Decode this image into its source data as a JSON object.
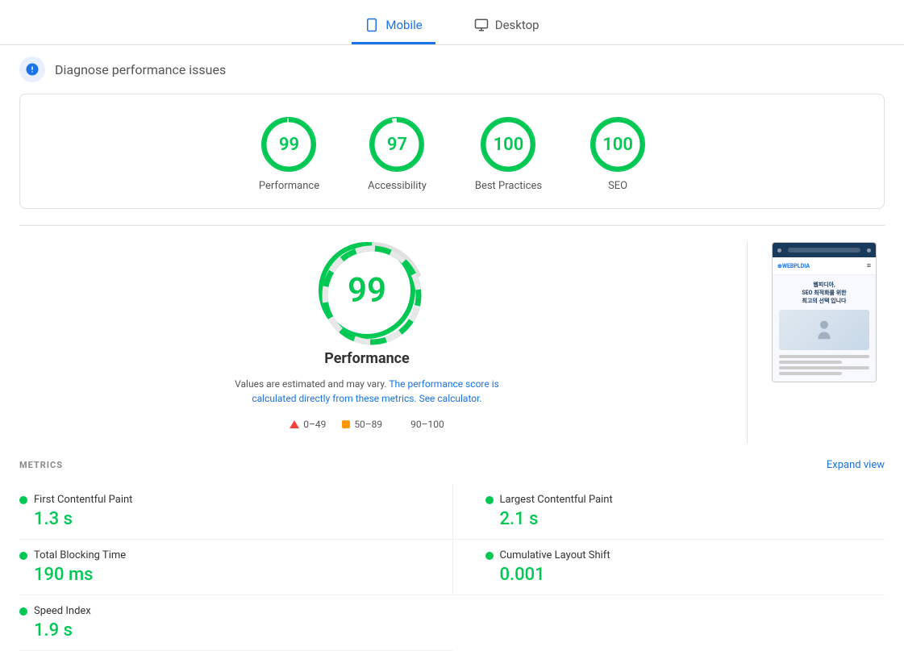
{
  "header": {
    "diagnose_label": "Diagnose performance issues"
  },
  "tabs": [
    {
      "id": "mobile",
      "label": "Mobile",
      "active": true
    },
    {
      "id": "desktop",
      "label": "Desktop",
      "active": false
    }
  ],
  "scores": [
    {
      "id": "performance",
      "value": "99",
      "label": "Performance"
    },
    {
      "id": "accessibility",
      "value": "97",
      "label": "Accessibility"
    },
    {
      "id": "best-practices",
      "value": "100",
      "label": "Best Practices"
    },
    {
      "id": "seo",
      "value": "100",
      "label": "SEO"
    }
  ],
  "main_score": {
    "value": "99",
    "title": "Performance",
    "description_static": "Values are estimated and may vary.",
    "description_link1": "The performance score is calculated directly from these metrics.",
    "description_link1_text": "The performance score is calculated",
    "description_link2_text": "See calculator.",
    "description_suffix": "directly from these metrics."
  },
  "legend": [
    {
      "type": "triangle",
      "range": "0–49"
    },
    {
      "type": "square",
      "range": "50–89"
    },
    {
      "type": "circle",
      "range": "90–100"
    }
  ],
  "site_preview": {
    "headline_line1": "웹피디아,",
    "headline_line2": "SEO 최적화를 위한",
    "headline_line3": "최고의 선택 입니다",
    "logo": "⊕WEBPLDIA"
  },
  "metrics": {
    "title": "METRICS",
    "expand_label": "Expand view",
    "items": [
      {
        "id": "fcp",
        "name": "First Contentful Paint",
        "value": "1.3 s",
        "color": "#00c853"
      },
      {
        "id": "lcp",
        "name": "Largest Contentful Paint",
        "value": "2.1 s",
        "color": "#00c853"
      },
      {
        "id": "tbt",
        "name": "Total Blocking Time",
        "value": "190 ms",
        "color": "#00c853"
      },
      {
        "id": "cls",
        "name": "Cumulative Layout Shift",
        "value": "0.001",
        "color": "#00c853"
      },
      {
        "id": "si",
        "name": "Speed Index",
        "value": "1.9 s",
        "color": "#00c853"
      }
    ]
  }
}
